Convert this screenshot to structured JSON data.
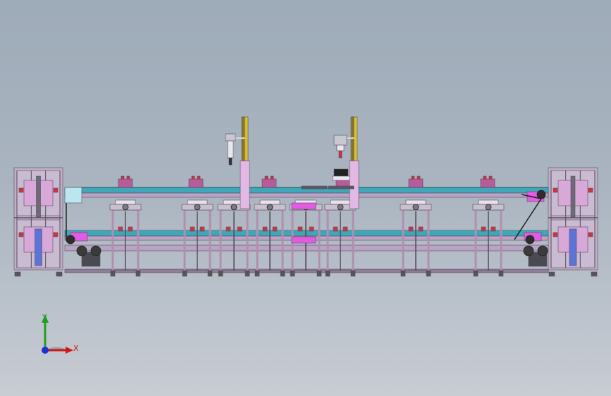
{
  "scene": {
    "colors": {
      "frame": "#b08fb0",
      "frame_dark": "#5a4a5e",
      "conveyor": "#3ea7b8",
      "highlight": "#e35be3",
      "red": "#d2323c",
      "cylinder": "#d8c033",
      "motor": "#4a4a52"
    }
  },
  "triad": {
    "y_label": "Y",
    "x_label": "X",
    "y_color": "#1fa01f",
    "x_color": "#d01818",
    "z_color": "#1f2fd0"
  }
}
